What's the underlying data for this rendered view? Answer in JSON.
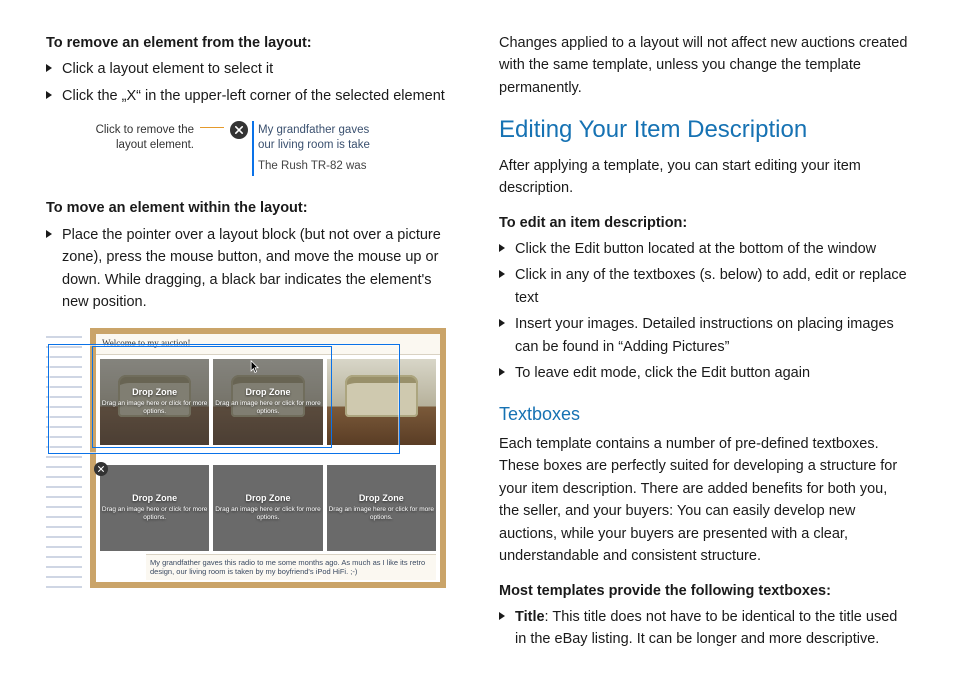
{
  "left": {
    "remove_heading": "To remove an element from the layout:",
    "remove_steps": [
      "Click a layout element to select it",
      "Click the „X“ in the upper-left corner of the selected element"
    ],
    "fig1": {
      "caption": "Click to remove the layout element.",
      "preview_line1": "My grandfather gaves",
      "preview_line2": "our living room is take",
      "preview_line3": "The Rush TR-82 was"
    },
    "move_heading": "To move an element within the layout:",
    "move_steps": [
      "Place the pointer over a layout block (but not over a picture zone), press the mouse button, and move the mouse up or down. While dragging, a black bar indicates the element's new position."
    ],
    "fig2": {
      "title": "Welcome to my auction!",
      "dz_label": "Drop Zone",
      "dz_sub": "Drag an image here or click for more options.",
      "bottom_text": "My grandfather gaves this radio to me some months ago. As much as I like its retro design, our living room is taken by my boyfriend's iPod HiFi. ;-)"
    }
  },
  "right": {
    "intro_para": "Changes applied to a layout will not affect new auctions created with the same template, unless you change the template perma­nently.",
    "h1": "Editing Your Item Description",
    "after_h1": "After applying a template, you can start editing your item descrip­tion.",
    "edit_heading": "To edit an item description:",
    "edit_steps": [
      "Click the Edit button located at the bottom of the window",
      "Click in any of the textboxes (s. below) to add, edit or replace text",
      "Insert your images. Detailed instructions on placing images can be found in “Adding Pictures”",
      "To leave edit mode, click the Edit button again"
    ],
    "h2": "Textboxes",
    "textboxes_para": "Each template contains a number of pre-defined textboxes. These boxes are perfectly suited for developing a structure for your item description. There are added benefits for both you, the seller, and your buyers: You can easily develop new auctions, while your buy­ers are presented with a clear, understandable and consistent structure.",
    "templates_heading": "Most templates provide the following textboxes:",
    "templates_items_html": [
      "<b>Title</b>: This title does not have to be identical to the title used in the eBay listing. It can be longer and more descriptive."
    ]
  }
}
